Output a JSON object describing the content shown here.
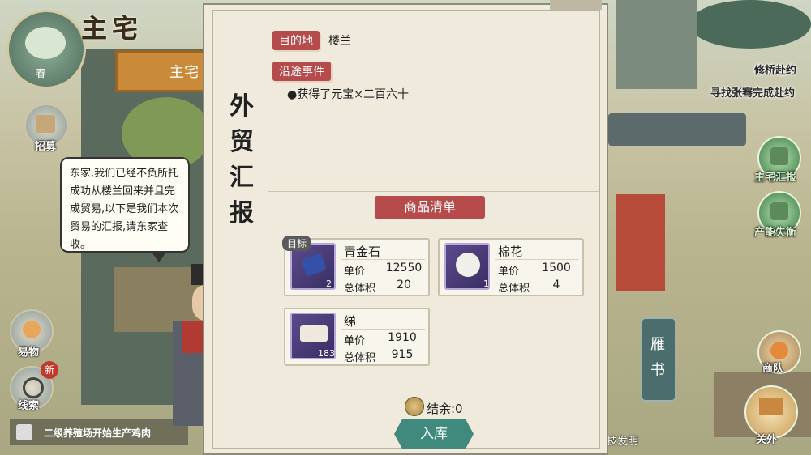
{
  "location": {
    "title": "主宅",
    "sign": "主宅"
  },
  "season": "春",
  "left_menu": [
    {
      "label": "招募"
    },
    {
      "label": "易物"
    },
    {
      "label": "线索",
      "badge": "新"
    }
  ],
  "notice": "二级养殖场开始生产鸡肉",
  "speech": "东家,我们已经不负所托成功从楼兰回来并且完成贸易,以下是我们本次贸易的汇报,请东家查收。",
  "right_panel": {
    "quest_1": "修桥赴约",
    "quest_2": "寻找张骞完成赴约",
    "btn_report": "主宅汇报",
    "btn_wealth": "产能失衡",
    "btn_caravan": "商队",
    "btn_outside": "关外",
    "bottom_hint": "技发明"
  },
  "report": {
    "vertical_title": [
      "外",
      "贸",
      "汇",
      "报"
    ],
    "dest_tag": "目的地",
    "dest_value": "楼兰",
    "event_tag": "沿途事件",
    "event_line": "●获得了元宝×二百六十",
    "goods_title": "商品清单",
    "price_label": "单价",
    "volume_label": "总体积",
    "target_badge": "目标",
    "goods": [
      {
        "name": "青金石",
        "icon": "lapis-icon",
        "count": "2",
        "price": "12550",
        "volume": "20"
      },
      {
        "name": "棉花",
        "icon": "cotton-icon",
        "count": "1",
        "price": "1500",
        "volume": "4"
      },
      {
        "name": "绨",
        "icon": "silk-icon",
        "count": "183",
        "price": "1910",
        "volume": "915"
      }
    ],
    "balance": "结余:0",
    "store_button": "入库",
    "side_tab": "雁书"
  },
  "colors": {
    "tag_red": "#b54b4b",
    "button_teal": "#3f8a7d",
    "item_purple": "#4a3d78"
  }
}
